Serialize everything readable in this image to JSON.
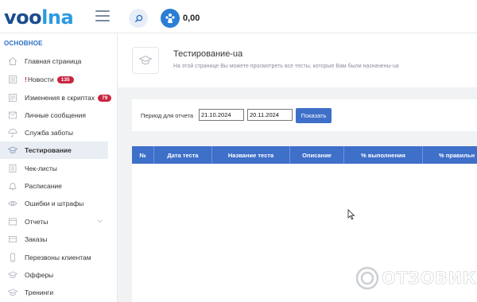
{
  "logo": {
    "part1": "vo",
    "part2": "o",
    "part3": "lna"
  },
  "topbar": {
    "balance": "0,00"
  },
  "sidebar": {
    "section_title": "ОСНОВНОЕ",
    "items": [
      {
        "label": "Главная страница",
        "icon": "home-icon"
      },
      {
        "label": "Новости",
        "badge": "135",
        "alert": "!",
        "icon": "news-icon"
      },
      {
        "label": "Изменения в скриптах",
        "badge": "79",
        "icon": "script-changes-icon"
      },
      {
        "label": "Личные сообщения",
        "icon": "messages-icon"
      },
      {
        "label": "Служба заботы",
        "icon": "umbrella-icon"
      },
      {
        "label": "Тестирование",
        "icon": "graduation-cap-icon"
      },
      {
        "label": "Чек-листы",
        "icon": "checklist-icon"
      },
      {
        "label": "Расписание",
        "icon": "bell-icon"
      },
      {
        "label": "Ошибки и штрафы",
        "icon": "eye-icon"
      },
      {
        "label": "Отчеты",
        "icon": "reports-icon"
      },
      {
        "label": "Заказы",
        "icon": "orders-icon"
      },
      {
        "label": "Перезвоны клиентам",
        "icon": "phone-icon"
      },
      {
        "label": "Офферы",
        "icon": "offers-icon"
      },
      {
        "label": "Тренинги",
        "icon": "trainings-icon"
      }
    ]
  },
  "header": {
    "title": "Тестирование-ua",
    "subtitle": "На этой странице Вы можете просмотреть все тесты, которые Вам были назначены-ua"
  },
  "filter": {
    "label": "Период для отчета",
    "date_from": "21.10.2024",
    "date_to": "20.11.2024",
    "button": "Показать"
  },
  "table": {
    "columns": [
      "№",
      "Дата теста",
      "Название теста",
      "Описание",
      "% выполнения",
      "% правильн"
    ]
  },
  "watermark": "ОТЗОВИК",
  "colors": {
    "accent": "#3e6fc9",
    "badge": "#c9243f",
    "brand": "#1b4d8f"
  }
}
